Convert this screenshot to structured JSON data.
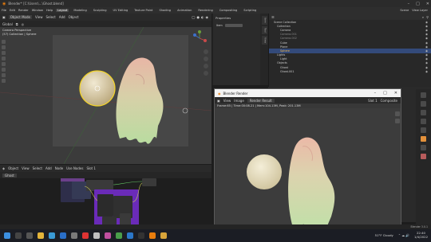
{
  "window": {
    "title": "Blender* [C:\\Users\\...\\Ghost.blend]"
  },
  "menubar": {
    "items": [
      "File",
      "Edit",
      "Render",
      "Window",
      "Help"
    ],
    "tabs": [
      "Layout",
      "Modeling",
      "Sculpting",
      "UV Editing",
      "Texture Paint",
      "Shading",
      "Animation",
      "Rendering",
      "Compositing",
      "Scripting"
    ],
    "active_tab": "Layout",
    "scene": "Scene",
    "view_layer": "View Layer"
  },
  "viewport": {
    "mode": "Object Mode",
    "menus": [
      "View",
      "Select",
      "Add",
      "Object"
    ],
    "orientation": "Global",
    "info_line1": "Camera Perspective",
    "info_line2": "(57) Collection | Sphere"
  },
  "npanel": {
    "header": "Properties",
    "tabs": [
      "Item",
      "Tool",
      "View"
    ],
    "row_label": "Item"
  },
  "outliner": {
    "rows": [
      {
        "label": "Scene Collection",
        "selected": false
      },
      {
        "label": "Collection",
        "selected": false
      },
      {
        "label": "Camera",
        "selected": false
      },
      {
        "label": "Camera.001",
        "selected": false
      },
      {
        "label": "Camera.002",
        "selected": false
      },
      {
        "label": "Cube",
        "selected": false
      },
      {
        "label": "Plane",
        "selected": false
      },
      {
        "label": "Sphere",
        "selected": true
      },
      {
        "label": "Lights",
        "selected": false
      },
      {
        "label": "Light",
        "selected": false
      },
      {
        "label": "Objects",
        "selected": false
      },
      {
        "label": "Ghost",
        "selected": false
      },
      {
        "label": "Ghost.001",
        "selected": false
      }
    ]
  },
  "node_editor": {
    "type": "Object",
    "menus": [
      "View",
      "Select",
      "Add",
      "Node"
    ],
    "use_nodes": "Use Nodes",
    "slot": "Slot 1",
    "material": "Ghost"
  },
  "render_window": {
    "title": "Blender Render",
    "menus": [
      "View",
      "Image"
    ],
    "image": "Render Result",
    "slot": "Slot 1",
    "layer": "Composite",
    "frame_info": "Frame:65 | Time:00:08.21 | Mem:104.13M, Peak: 201.13M"
  },
  "status": {
    "version": "Blender 3.0.1"
  },
  "taskbar": {
    "weather": "51°F Cloudy",
    "time": "22:40",
    "date": "1/4/2022"
  },
  "colors": {
    "accent": "#4772b3",
    "selection": "#334a7a",
    "ghost_body": "#cde3b0",
    "ghost_tip": "#e8b6a6"
  }
}
